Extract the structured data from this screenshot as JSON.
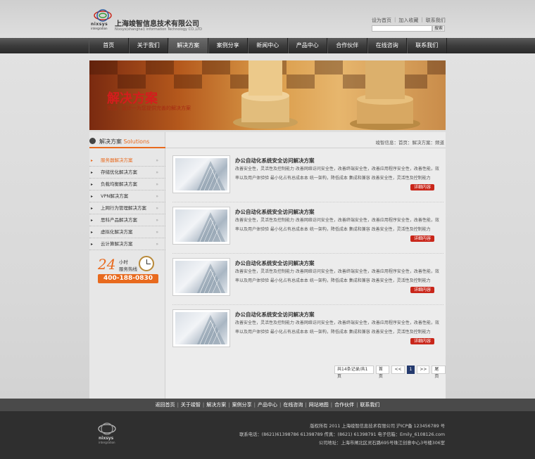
{
  "header": {
    "logo_text": "nixsys",
    "logo_sub": "intergration",
    "company_cn": "上海竣智信息技术有限公司",
    "company_en": "Nixsys(shanghai) information Technology CO.,LTD",
    "top_links": [
      "设为首页",
      "加入收藏",
      "联系我们"
    ],
    "search_placeholder": "",
    "search_button": "搜索"
  },
  "nav": [
    "首页",
    "关于我们",
    "解决方案",
    "案例分享",
    "新闻中心",
    "产品中心",
    "合作伙伴",
    "在线咨询",
    "联系我们"
  ],
  "nav_active_index": 2,
  "banner": {
    "title": "解决方案",
    "subtitle": "策划、设计一为您提供完善的解决方案"
  },
  "sidebar": {
    "title_cn": "解决方案",
    "title_en": "Solutions",
    "items": [
      "服务器解决方案",
      "存储优化解决方案",
      "负载均衡解决方案",
      "VPN解决方案",
      "上网行为管理解决方案",
      "思科产品解决方案",
      "虚拟化解决方案",
      "云计算解决方案"
    ],
    "active_index": 0,
    "arrow": "»",
    "hotline": {
      "big": "24",
      "label1": "小时",
      "label2": "服务热线",
      "number": "400-188-0830"
    }
  },
  "breadcrumb": "竣智信息：首页：解决方案：频道",
  "articles": [
    {
      "title": "办公自动化系统安全访问解决方案",
      "text": "改善安全性，灵活性及控制能力 改善网络访问安全性，改善终端安全性，改善应用程序安全性，改善性能，效率以及用户体验验 最小化占有总成本本 统一架构，降低成本 集成和兼容 改善安全性，灵活性及控制能力",
      "button": "详细内容"
    },
    {
      "title": "办公自动化系统安全访问解决方案",
      "text": "改善安全性，灵活性及控制能力 改善网络访问安全性，改善终端安全性，改善应用程序安全性，改善性能，效率以及用户体验验 最小化占有总成本本 统一架构，降低成本 集成和兼容 改善安全性，灵活性及控制能力",
      "button": "详细内容"
    },
    {
      "title": "办公自动化系统安全访问解决方案",
      "text": "改善安全性，灵活性及控制能力 改善网络访问安全性，改善终端安全性，改善应用程序安全性，改善性能，效率以及用户体验验 最小化占有总成本本 统一架构，降低成本 集成和兼容 改善安全性，灵活性及控制能力",
      "button": "详细内容"
    },
    {
      "title": "办公自动化系统安全访问解决方案",
      "text": "改善安全性，灵活性及控制能力 改善网络访问安全性，改善终端安全性，改善应用程序安全性，改善性能，效率以及用户体验验 最小化占有总成本本 统一架构，降低成本 集成和兼容 改善安全性，灵活性及控制能力",
      "button": "详细内容"
    }
  ],
  "pager": {
    "summary": "共14条记录/共1页",
    "first": "首页",
    "prev": "<<",
    "current": "1",
    "next": ">>",
    "last": "尾页"
  },
  "footer_links": [
    "返回首页",
    "关于竣智",
    "解决方案",
    "案例分享",
    "产品中心",
    "在线咨询",
    "网站地图",
    "合作伙伴",
    "联系我们"
  ],
  "footer": {
    "logo_text": "nixsys",
    "logo_sub": "intergration",
    "line1": "版权所有 2011  上海竣智信息技术有限公司  沪ICP备 123456789 号",
    "line2": "联系电话：(8621)61398786 61398789   传真：(8621) 61398791  电子信箱：Emily_6108126.com",
    "line3": "公司地址：上海市闸北区灵石路695号珠江创意中心3号楼306室"
  },
  "colors": {
    "accent": "#e86a1e",
    "button_red": "#c9261a",
    "nav_bg": "#3c3c3c",
    "footer_bg": "#2f2f2f"
  }
}
